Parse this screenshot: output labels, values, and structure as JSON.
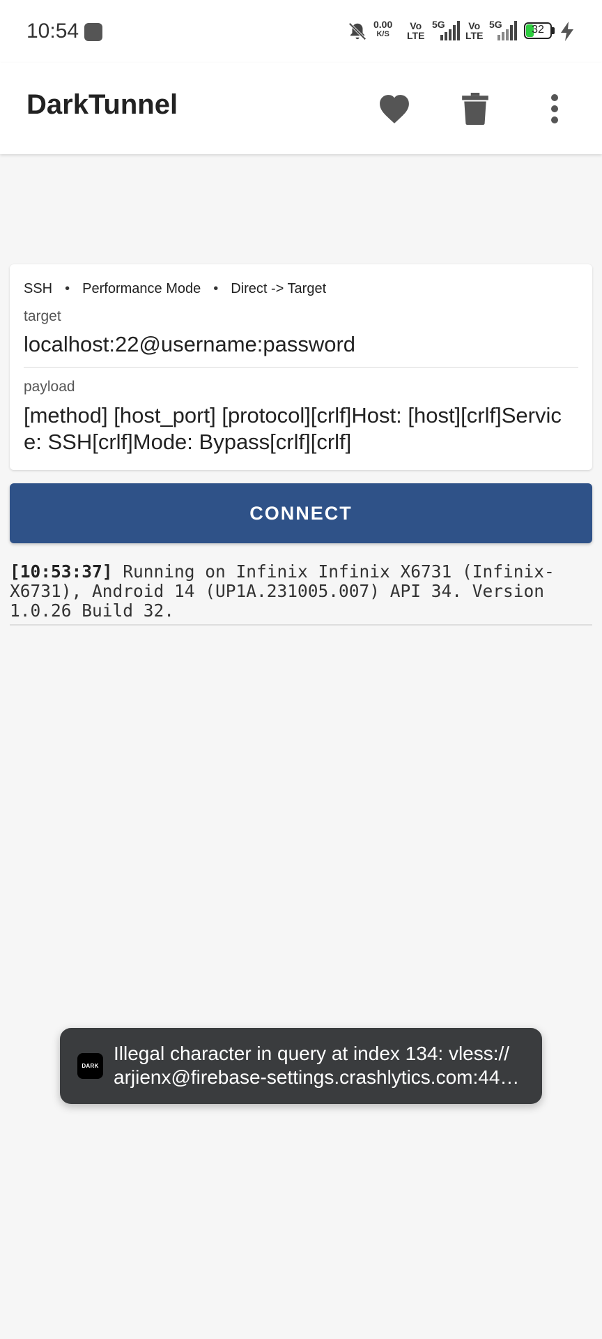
{
  "status_bar": {
    "time": "10:54",
    "net_speed_value": "0.00",
    "net_speed_unit": "K/S",
    "volte1_top": "Vo",
    "volte1_bottom": "LTE",
    "sim1_network": "5G",
    "volte2_top": "Vo",
    "volte2_bottom": "LTE",
    "sim2_network": "5G",
    "battery_level": "32",
    "icons": [
      "app-notification-icon",
      "bell-muted-icon",
      "signal-icon",
      "battery-icon",
      "charging-bolt-icon"
    ]
  },
  "appbar": {
    "title": "DarkTunnel",
    "actions": [
      "heart-icon",
      "trash-icon",
      "more-vert-icon"
    ]
  },
  "config": {
    "protocol": "SSH",
    "mode": "Performance Mode",
    "route": "Direct -> Target",
    "separator": "•",
    "target_label": "target",
    "target_value": "localhost:22@username:password",
    "payload_label": "payload",
    "payload_value": "[method] [host_port] [protocol][crlf]Host: [host][crlf]Service: SSH[crlf]Mode: Bypass[crlf][crlf]"
  },
  "connect_label": "CONNECT",
  "log": {
    "timestamp": "[10:53:37]",
    "message": " Running on Infinix Infinix X6731 (Infinix-X6731), Android 14 (UP1A.231005.007) API 34. Version 1.0.26 Build 32."
  },
  "toast": {
    "icon_text": "DARK",
    "line1": "Illegal character in query at index 134: vless://",
    "line2": "arjienx@firebase-settings.crashlytics.com:44…"
  },
  "colors": {
    "accent": "#2f5288",
    "background": "#f6f6f6",
    "toast_bg": "#3a3c3e",
    "battery_green": "#2ecc40"
  }
}
